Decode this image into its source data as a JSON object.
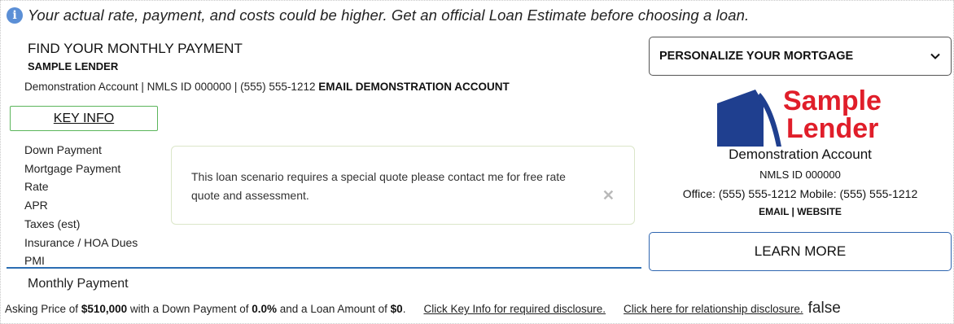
{
  "notice": {
    "icon": "info-icon",
    "text": "Your actual rate, payment, and costs could be higher. Get an official Loan Estimate before choosing a loan."
  },
  "header": {
    "title": "FIND YOUR MONTHLY PAYMENT",
    "lender": "SAMPLE LENDER",
    "contact": "Demonstration Account | NMLS ID 000000 | (555) 555-1212",
    "email_link": "EMAIL DEMONSTRATION ACCOUNT"
  },
  "key_info": {
    "button_label": "KEY INFO",
    "items": [
      "Down Payment",
      "Mortgage Payment",
      "Rate",
      "APR",
      "Taxes (est)",
      "Insurance / HOA Dues",
      "PMI"
    ]
  },
  "message": {
    "text": "This loan scenario requires a special quote please contact me for free rate quote and assessment.",
    "close": "✕"
  },
  "summary": {
    "monthly_label": "Monthly Payment",
    "asking_prefix": "Asking Price of",
    "asking_price": "$510,000",
    "down_prefix": "with a Down Payment of",
    "down_payment": "0.0%",
    "loan_prefix": "and a Loan Amount of",
    "loan_amount": "$0",
    "loan_suffix": ".",
    "key_disclosure_link": "Click Key Info for required disclosure.",
    "relationship_link": "Click here for relationship disclosure.",
    "flag": "false"
  },
  "sidebar": {
    "select_label": "PERSONALIZE YOUR MORTGAGE",
    "logo_line1": "Sample",
    "logo_line2": "Lender",
    "account_name": "Demonstration Account",
    "nmls": "NMLS ID 000000",
    "office": "Office: (555) 555-1212 Mobile: (555) 555-1212",
    "links": "EMAIL | WEBSITE",
    "learn_more": "LEARN MORE"
  },
  "colors": {
    "accent_blue": "#2f66b0",
    "brand_red": "#e01e2a",
    "brand_navy": "#1f3f8f",
    "key_info_border": "#5bb55b"
  }
}
